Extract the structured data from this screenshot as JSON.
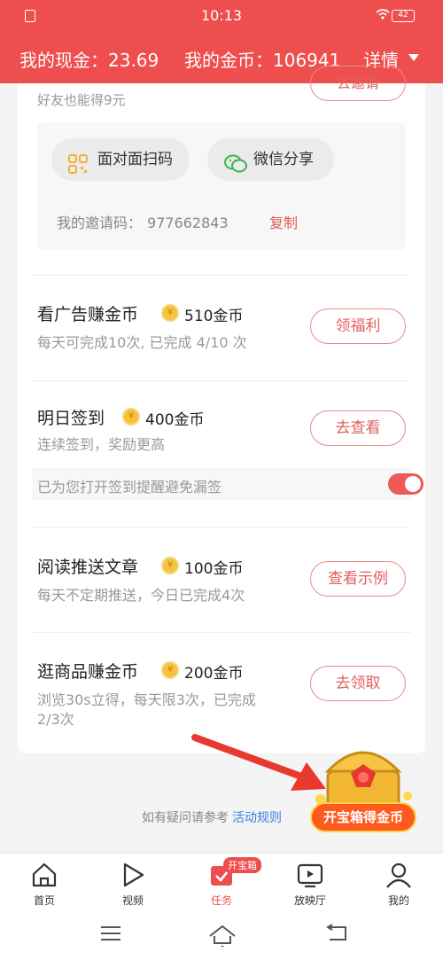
{
  "status_bar": {
    "time": "10:13",
    "battery": "42"
  },
  "header": {
    "cash_label": "我的现金：23.69",
    "coins_label": "我的金币：106941",
    "details_label": "详情"
  },
  "invite": {
    "subtitle": "好友也能得9元",
    "button_label": "去邀请",
    "scan_label": "面对面扫码",
    "wechat_label": "微信分享",
    "code_label": "我的邀请码：",
    "code_value": "977662843",
    "copy_label": "复制"
  },
  "tasks": [
    {
      "title": "看广告赚金币",
      "reward": "510金币",
      "desc": "每天可完成10次, 已完成 4/10 次",
      "button": "领福利"
    },
    {
      "title": "明日签到",
      "reward": "400金币",
      "desc": "连续签到，奖励更高",
      "button": "去查看",
      "reminder": "已为您打开签到提醒避免漏签",
      "reminder_on": true
    },
    {
      "title": "阅读推送文章",
      "reward": "100金币",
      "desc": "每天不定期推送，今日已完成4次",
      "button": "查看示例"
    },
    {
      "title": "逛商品赚金币",
      "reward": "200金币",
      "desc_line1": "浏览30s立得，每天限3次，已完成",
      "desc_line2": "2/3次",
      "button": "去领取"
    }
  ],
  "coin_glyph": "¥",
  "footer": {
    "help_text": "如有疑问请参考",
    "help_link": "活动规则",
    "treasure_label": "开宝箱得金币"
  },
  "tabbar": {
    "items": [
      {
        "label": "首页",
        "icon": "home-icon"
      },
      {
        "label": "视频",
        "icon": "play-icon"
      },
      {
        "label": "任务",
        "icon": "task-icon",
        "badge": "开宝箱",
        "active": true
      },
      {
        "label": "放映厅",
        "icon": "tv-icon"
      },
      {
        "label": "我的",
        "icon": "user-icon"
      }
    ]
  },
  "colors": {
    "brand": "#ee4e4e",
    "button_border": "#e98a88",
    "link": "#3b7ee0",
    "coin": "#f7c23c"
  }
}
